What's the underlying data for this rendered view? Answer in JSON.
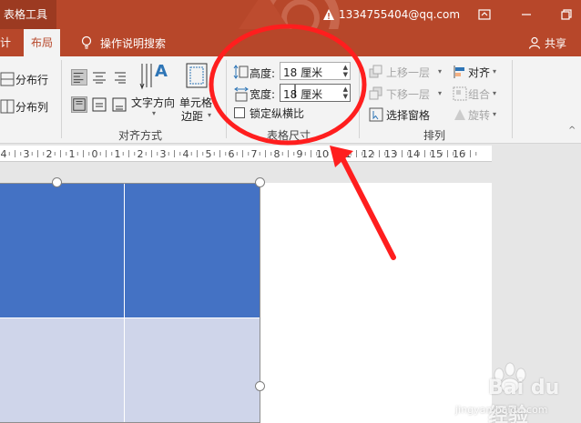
{
  "titlebar": {
    "context_tools": "表格工具",
    "account_email": "1334755404@qq.com"
  },
  "tabs": {
    "partial_left": "计",
    "layout": "布局",
    "tell_me": "操作说明搜索",
    "share": "共享"
  },
  "ribbon": {
    "distribute_rows": "分布行",
    "distribute_cols": "分布列",
    "text_direction": "文字方向",
    "cell_margins_line1": "单元格",
    "cell_margins_line2": "边距",
    "align_group": "对齐方式",
    "height_label": "高度:",
    "height_value": "18 厘米",
    "width_label": "宽度:",
    "width_value": "18 厘米",
    "lock_ratio": "锁定纵横比",
    "size_group": "表格尺寸",
    "bring_forward": "上移一层",
    "send_backward": "下移一层",
    "selection_pane": "选择窗格",
    "align": "对齐",
    "group": "组合",
    "rotate": "旋转",
    "arrange_group": "排列"
  },
  "ruler": {
    "labels": [
      "4",
      "3",
      "2",
      "1",
      "0",
      "1",
      "2",
      "3",
      "4",
      "5",
      "6",
      "7",
      "8",
      "9",
      "10",
      "11",
      "12",
      "13",
      "14",
      "15",
      "16"
    ]
  },
  "colors": {
    "accent": "#b7472a",
    "header_cell": "#4472c4",
    "body_cell": "#cfd5ea",
    "annotation": "#ff1e1e"
  },
  "watermark": {
    "brand": "Bai du 经验",
    "url": "jingyan.baidu.com"
  }
}
